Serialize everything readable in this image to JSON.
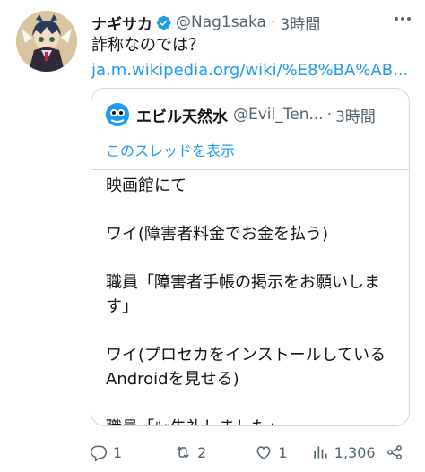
{
  "tweet": {
    "author": {
      "name": "ナギサカ",
      "handle": "@Nag1saka",
      "separator": "·",
      "time": "3時間"
    },
    "text": "詐称なのでは？",
    "link": "ja.m.wikipedia.org/wiki/%E8%BA%AB...",
    "accent_color": "#1d9bf0"
  },
  "quote": {
    "author": {
      "name": "エビル天然水",
      "handle": "@Evil_Ten...",
      "separator": "·",
      "time": "3時間"
    },
    "show_thread": "このスレッドを表示",
    "lines": [
      "映画館にて",
      "ワイ(障害者料金でお金を払う)",
      "職員「障害者手帳の掲示をお願いしま",
      "す」",
      "ワイ(プロセカをインストールしている",
      "Androidを見せる)",
      "職員「ﾊｯ失礼しました」"
    ]
  },
  "actions": {
    "reply": {
      "icon": "reply-icon",
      "count": "1"
    },
    "retweet": {
      "icon": "retweet-icon",
      "count": "2"
    },
    "like": {
      "icon": "heart-icon",
      "count": "1"
    },
    "views": {
      "icon": "views-icon",
      "count": "1,306"
    },
    "share": {
      "icon": "share-icon"
    }
  }
}
